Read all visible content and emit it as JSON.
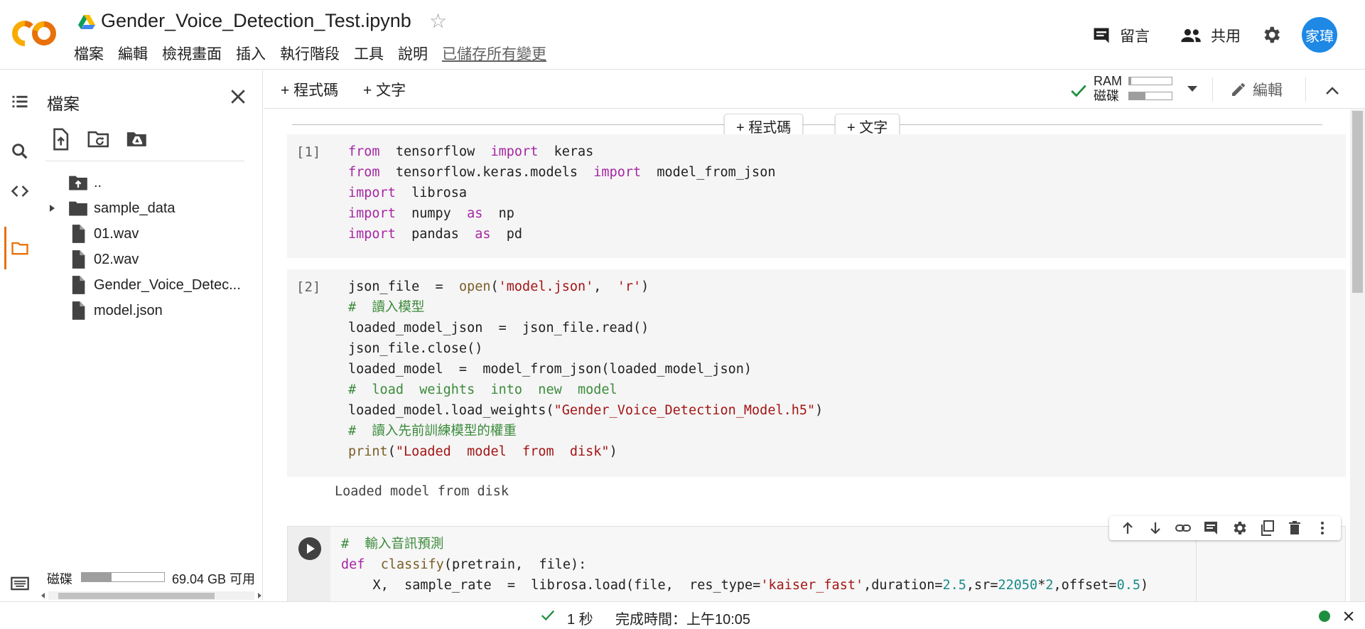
{
  "header": {
    "notebook_title": "Gender_Voice_Detection_Test.ipynb",
    "menu": [
      "檔案",
      "編輯",
      "檢視畫面",
      "插入",
      "執行階段",
      "工具",
      "說明"
    ],
    "saved_status": "已儲存所有變更",
    "comment_label": "留言",
    "share_label": "共用",
    "avatar_text": "家瑋",
    "avatar_color": "#1e88e5"
  },
  "rail": {
    "icons": [
      "toc-icon",
      "search-icon",
      "code-snippets-icon",
      "folder-icon"
    ],
    "active": "folder-icon",
    "active_color": "#e8710a"
  },
  "file_panel": {
    "title": "檔案",
    "tools": [
      "upload-file-icon",
      "refresh-folder-icon",
      "mount-drive-icon"
    ],
    "items": [
      {
        "name": "..",
        "type": "parent-folder"
      },
      {
        "name": "sample_data",
        "type": "folder",
        "expandable": true
      },
      {
        "name": "01.wav",
        "type": "file"
      },
      {
        "name": "02.wav",
        "type": "file"
      },
      {
        "name": "Gender_Voice_Detec...",
        "type": "file"
      },
      {
        "name": "model.json",
        "type": "file"
      }
    ],
    "disk_label": "磁碟",
    "disk_free": "69.04 GB 可用",
    "disk_used_fraction": 0.36
  },
  "toolbar": {
    "add_code": "+ 程式碼",
    "add_text": "+ 文字",
    "ram_label": "RAM",
    "disk_label": "磁碟",
    "ram_fraction": 0.05,
    "disk_fraction": 0.38,
    "edit_label": "編輯"
  },
  "insert_bar": {
    "add_code": "+ 程式碼",
    "add_text": "+ 文字"
  },
  "cells": [
    {
      "count": "[1]"
    },
    {
      "count": "[2]",
      "output": "Loaded model from disk"
    },
    {
      "count": ""
    }
  ],
  "cell_toolbar": [
    "move-up-icon",
    "move-down-icon",
    "link-icon",
    "comment-icon",
    "cell-settings-icon",
    "mirror-cell-icon",
    "delete-icon",
    "more-icon"
  ],
  "status": {
    "duration": "1 秒",
    "completed": "完成時間：上午10:05",
    "ok_color": "#1e8e3e"
  }
}
